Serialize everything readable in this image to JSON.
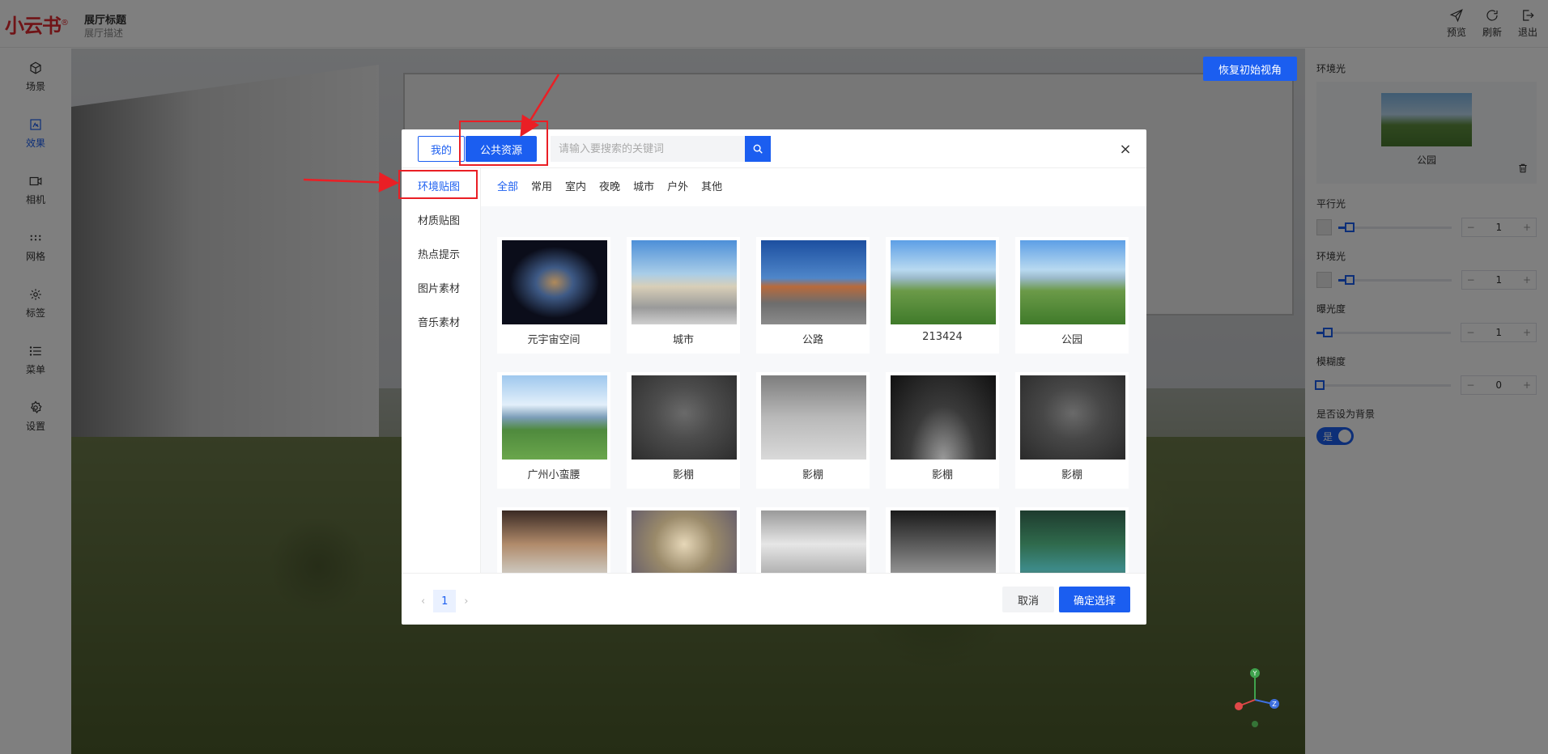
{
  "brand": {
    "logo_text": "小云书",
    "registered": "®"
  },
  "hall": {
    "title": "展厅标题",
    "description": "展厅描述"
  },
  "top_actions": [
    {
      "label": "预览",
      "icon": "send-icon"
    },
    {
      "label": "刷新",
      "icon": "refresh-icon"
    },
    {
      "label": "退出",
      "icon": "logout-icon"
    }
  ],
  "left_nav": [
    {
      "label": "场景",
      "icon": "cube-icon",
      "active": false
    },
    {
      "label": "效果",
      "icon": "effect-icon",
      "active": true
    },
    {
      "label": "相机",
      "icon": "camera-icon",
      "active": false
    },
    {
      "label": "网格",
      "icon": "grid-icon",
      "active": false
    },
    {
      "label": "标签",
      "icon": "tag-icon",
      "active": false
    },
    {
      "label": "菜单",
      "icon": "menu-icon",
      "active": false
    },
    {
      "label": "设置",
      "icon": "gear-icon",
      "active": false
    }
  ],
  "scene": {
    "restore_view_label": "恢复初始视角",
    "axis_labels": {
      "y": "Y",
      "z": "Z"
    }
  },
  "right_panel": {
    "env_light_section": "环境光",
    "env_map_name": "公园",
    "parallel_light_label": "平行光",
    "parallel_light_value": "1",
    "ambient_light_label": "环境光",
    "ambient_light_value": "1",
    "exposure_label": "曝光度",
    "exposure_value": "1",
    "blur_label": "模糊度",
    "blur_value": "0",
    "as_background_label": "是否设为背景",
    "toggle_label": "是",
    "minus": "−",
    "plus": "+"
  },
  "modal": {
    "tab_mine": "我的",
    "tab_public": "公共资源",
    "search_placeholder": "请输入要搜索的关键词",
    "close": "×",
    "side_items": [
      "环境贴图",
      "材质贴图",
      "热点提示",
      "图片素材",
      "音乐素材"
    ],
    "filters": [
      "全部",
      "常用",
      "室内",
      "夜晚",
      "城市",
      "户外",
      "其他"
    ],
    "cards": [
      {
        "name": "元宇宙空间"
      },
      {
        "name": "城市"
      },
      {
        "name": "公路"
      },
      {
        "name": "213424"
      },
      {
        "name": "公园"
      },
      {
        "name": "广州小蛮腰"
      },
      {
        "name": "影棚"
      },
      {
        "name": "影棚"
      },
      {
        "name": "影棚"
      },
      {
        "name": "影棚"
      },
      {
        "name": ""
      },
      {
        "name": ""
      },
      {
        "name": ""
      },
      {
        "name": ""
      },
      {
        "name": ""
      }
    ],
    "pager": {
      "prev": "‹",
      "current": "1",
      "next": "›"
    },
    "cancel_label": "取消",
    "confirm_label": "确定选择"
  },
  "colors": {
    "primary": "#1b5ef0",
    "annotation": "#ea1f25",
    "logo": "#e0282e"
  }
}
